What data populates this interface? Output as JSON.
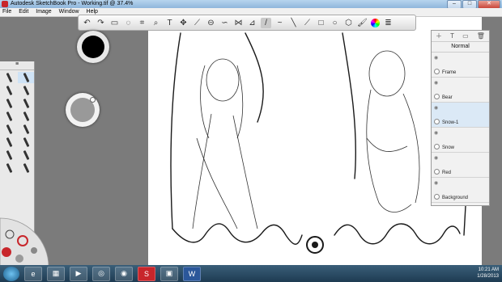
{
  "window": {
    "title": "Autodesk SketchBook Pro - Working.tif @ 37.4%",
    "min": "–",
    "max": "□",
    "close": "✕"
  },
  "menu": [
    "File",
    "Edit",
    "Image",
    "Window",
    "Help"
  ],
  "lagoon_header": "≡",
  "layers": {
    "blend_mode": "Normal",
    "items": [
      {
        "label": "Frame"
      },
      {
        "label": "Bear"
      },
      {
        "label": "Snow-1"
      },
      {
        "label": "Snow"
      },
      {
        "label": "Red"
      },
      {
        "label": "Background"
      }
    ]
  },
  "tray": {
    "time": "10:21 AM",
    "date": "1/28/2013"
  },
  "colors": {
    "accent": "#c8262b",
    "titlebar": "#9fc2e4",
    "canvas_bg": "#7b7b7b"
  }
}
